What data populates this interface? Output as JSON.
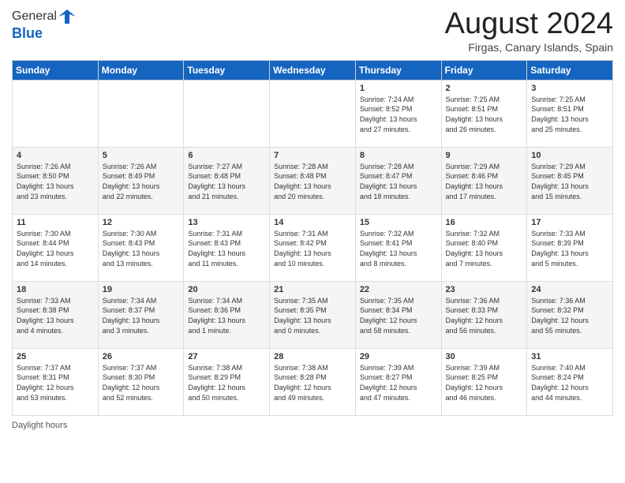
{
  "header": {
    "logo_general": "General",
    "logo_blue": "Blue",
    "month_year": "August 2024",
    "location": "Firgas, Canary Islands, Spain"
  },
  "days_of_week": [
    "Sunday",
    "Monday",
    "Tuesday",
    "Wednesday",
    "Thursday",
    "Friday",
    "Saturday"
  ],
  "weeks": [
    [
      {
        "day": "",
        "info": ""
      },
      {
        "day": "",
        "info": ""
      },
      {
        "day": "",
        "info": ""
      },
      {
        "day": "",
        "info": ""
      },
      {
        "day": "1",
        "info": "Sunrise: 7:24 AM\nSunset: 8:52 PM\nDaylight: 13 hours\nand 27 minutes."
      },
      {
        "day": "2",
        "info": "Sunrise: 7:25 AM\nSunset: 8:51 PM\nDaylight: 13 hours\nand 26 minutes."
      },
      {
        "day": "3",
        "info": "Sunrise: 7:25 AM\nSunset: 8:51 PM\nDaylight: 13 hours\nand 25 minutes."
      }
    ],
    [
      {
        "day": "4",
        "info": "Sunrise: 7:26 AM\nSunset: 8:50 PM\nDaylight: 13 hours\nand 23 minutes."
      },
      {
        "day": "5",
        "info": "Sunrise: 7:26 AM\nSunset: 8:49 PM\nDaylight: 13 hours\nand 22 minutes."
      },
      {
        "day": "6",
        "info": "Sunrise: 7:27 AM\nSunset: 8:48 PM\nDaylight: 13 hours\nand 21 minutes."
      },
      {
        "day": "7",
        "info": "Sunrise: 7:28 AM\nSunset: 8:48 PM\nDaylight: 13 hours\nand 20 minutes."
      },
      {
        "day": "8",
        "info": "Sunrise: 7:28 AM\nSunset: 8:47 PM\nDaylight: 13 hours\nand 18 minutes."
      },
      {
        "day": "9",
        "info": "Sunrise: 7:29 AM\nSunset: 8:46 PM\nDaylight: 13 hours\nand 17 minutes."
      },
      {
        "day": "10",
        "info": "Sunrise: 7:29 AM\nSunset: 8:45 PM\nDaylight: 13 hours\nand 15 minutes."
      }
    ],
    [
      {
        "day": "11",
        "info": "Sunrise: 7:30 AM\nSunset: 8:44 PM\nDaylight: 13 hours\nand 14 minutes."
      },
      {
        "day": "12",
        "info": "Sunrise: 7:30 AM\nSunset: 8:43 PM\nDaylight: 13 hours\nand 13 minutes."
      },
      {
        "day": "13",
        "info": "Sunrise: 7:31 AM\nSunset: 8:43 PM\nDaylight: 13 hours\nand 11 minutes."
      },
      {
        "day": "14",
        "info": "Sunrise: 7:31 AM\nSunset: 8:42 PM\nDaylight: 13 hours\nand 10 minutes."
      },
      {
        "day": "15",
        "info": "Sunrise: 7:32 AM\nSunset: 8:41 PM\nDaylight: 13 hours\nand 8 minutes."
      },
      {
        "day": "16",
        "info": "Sunrise: 7:32 AM\nSunset: 8:40 PM\nDaylight: 13 hours\nand 7 minutes."
      },
      {
        "day": "17",
        "info": "Sunrise: 7:33 AM\nSunset: 8:39 PM\nDaylight: 13 hours\nand 5 minutes."
      }
    ],
    [
      {
        "day": "18",
        "info": "Sunrise: 7:33 AM\nSunset: 8:38 PM\nDaylight: 13 hours\nand 4 minutes."
      },
      {
        "day": "19",
        "info": "Sunrise: 7:34 AM\nSunset: 8:37 PM\nDaylight: 13 hours\nand 3 minutes."
      },
      {
        "day": "20",
        "info": "Sunrise: 7:34 AM\nSunset: 8:36 PM\nDaylight: 13 hours\nand 1 minute."
      },
      {
        "day": "21",
        "info": "Sunrise: 7:35 AM\nSunset: 8:35 PM\nDaylight: 13 hours\nand 0 minutes."
      },
      {
        "day": "22",
        "info": "Sunrise: 7:35 AM\nSunset: 8:34 PM\nDaylight: 12 hours\nand 58 minutes."
      },
      {
        "day": "23",
        "info": "Sunrise: 7:36 AM\nSunset: 8:33 PM\nDaylight: 12 hours\nand 56 minutes."
      },
      {
        "day": "24",
        "info": "Sunrise: 7:36 AM\nSunset: 8:32 PM\nDaylight: 12 hours\nand 55 minutes."
      }
    ],
    [
      {
        "day": "25",
        "info": "Sunrise: 7:37 AM\nSunset: 8:31 PM\nDaylight: 12 hours\nand 53 minutes."
      },
      {
        "day": "26",
        "info": "Sunrise: 7:37 AM\nSunset: 8:30 PM\nDaylight: 12 hours\nand 52 minutes."
      },
      {
        "day": "27",
        "info": "Sunrise: 7:38 AM\nSunset: 8:29 PM\nDaylight: 12 hours\nand 50 minutes."
      },
      {
        "day": "28",
        "info": "Sunrise: 7:38 AM\nSunset: 8:28 PM\nDaylight: 12 hours\nand 49 minutes."
      },
      {
        "day": "29",
        "info": "Sunrise: 7:39 AM\nSunset: 8:27 PM\nDaylight: 12 hours\nand 47 minutes."
      },
      {
        "day": "30",
        "info": "Sunrise: 7:39 AM\nSunset: 8:25 PM\nDaylight: 12 hours\nand 46 minutes."
      },
      {
        "day": "31",
        "info": "Sunrise: 7:40 AM\nSunset: 8:24 PM\nDaylight: 12 hours\nand 44 minutes."
      }
    ]
  ],
  "footer": {
    "daylight_label": "Daylight hours"
  }
}
